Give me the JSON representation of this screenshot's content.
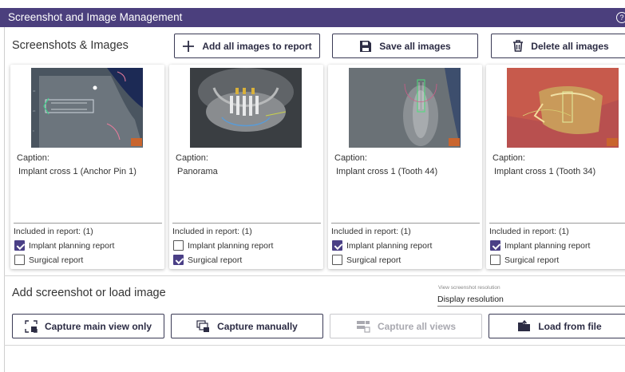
{
  "window": {
    "title": "Screenshot and Image Management",
    "help_icon": "?"
  },
  "images_section": {
    "title": "Screenshots & Images",
    "buttons": {
      "add_all": "Add all images to report",
      "save_all": "Save all images",
      "delete_all": "Delete all images"
    }
  },
  "cards": [
    {
      "caption_label": "Caption:",
      "caption": "Implant cross 1 (Anchor Pin 1)",
      "included": "Included in report: (1)",
      "implant_label": "Implant planning report",
      "implant_checked": true,
      "surgical_label": "Surgical report",
      "surgical_checked": false
    },
    {
      "caption_label": "Caption:",
      "caption": "Panorama",
      "included": "Included in report: (1)",
      "implant_label": "Implant planning report",
      "implant_checked": false,
      "surgical_label": "Surgical report",
      "surgical_checked": true
    },
    {
      "caption_label": "Caption:",
      "caption": "Implant cross 1 (Tooth 44)",
      "included": "Included in report: (1)",
      "implant_label": "Implant planning report",
      "implant_checked": true,
      "surgical_label": "Surgical report",
      "surgical_checked": false
    },
    {
      "caption_label": "Caption:",
      "caption": "Implant cross 1 (Tooth 34)",
      "included": "Included in report: (1)",
      "implant_label": "Implant planning report",
      "implant_checked": true,
      "surgical_label": "Surgical report",
      "surgical_checked": false
    }
  ],
  "capture_section": {
    "title": "Add screenshot or load image",
    "resolution_label": "View screenshot resolution",
    "resolution_value": "Display resolution",
    "buttons": {
      "capture_main": "Capture main view only",
      "capture_manual": "Capture manually",
      "capture_all": "Capture all views",
      "load_file": "Load from file"
    }
  },
  "colors": {
    "title_bar": "#4b3f7d",
    "checkbox_checked": "#4a3f86",
    "button_text": "#2c2c44"
  }
}
